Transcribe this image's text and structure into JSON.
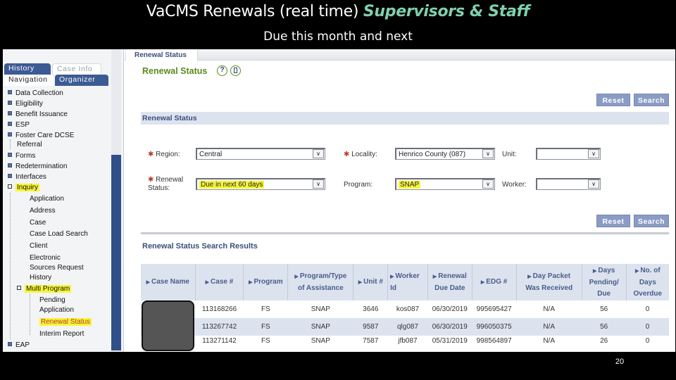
{
  "slide": {
    "title_main": "VaCMS Renewals (real time) ",
    "title_accent": "Supervisors & Staff",
    "subtitle": "Due this month and next",
    "page_number": "20",
    "accent_color": "#7fd1b0"
  },
  "sidebar": {
    "tabs": {
      "history": "History",
      "case_info": "Case Info",
      "navigation": "Navigation",
      "organizer": "Organizer"
    },
    "items": [
      {
        "label": "Data Collection"
      },
      {
        "label": "Eligibility"
      },
      {
        "label": "Benefit Issuance"
      },
      {
        "label": "ESP"
      },
      {
        "label": "Foster Care DCSE",
        "label2": "Referral"
      },
      {
        "label": "Forms"
      },
      {
        "label": "Redetermination"
      },
      {
        "label": "Interfaces"
      },
      {
        "label": "Inquiry"
      },
      {
        "label": "EAP"
      }
    ],
    "inquiry_children": [
      "Application",
      "Address",
      "Case",
      "Case Load Search",
      "Client",
      "Electronic",
      "Sources Request",
      "History"
    ],
    "multi_program": "Multi Program",
    "multi_program_children": {
      "pending_1": "Pending",
      "pending_2": "Application",
      "renewal_status": "Renewal Status",
      "interim_report": "Interim Report"
    }
  },
  "main": {
    "tab_label": "Renewal Status",
    "page_heading": "Renewal Status",
    "help_icon": "?",
    "buttons": {
      "reset": "Reset",
      "search": "Search"
    },
    "filter_section_title": "Renewal Status",
    "filters": {
      "region": {
        "label": "Region:",
        "value": "Central",
        "required": true
      },
      "locality": {
        "label": "Locality:",
        "value": "Henrico County (087)",
        "required": true
      },
      "unit": {
        "label": "Unit:",
        "value": ""
      },
      "renewal_status": {
        "label1": "Renewal",
        "label2": "Status:",
        "value": "Due in next 60 days",
        "required": true
      },
      "program": {
        "label": "Program:",
        "value": "SNAP"
      },
      "worker": {
        "label": "Worker:",
        "value": ""
      }
    },
    "required_marker": "✱",
    "dropdown_arrow": "∨",
    "results_title": "Renewal Status Search Results",
    "results": {
      "columns": [
        {
          "l1": "Case Name",
          "l2": ""
        },
        {
          "l1": "Case #",
          "l2": ""
        },
        {
          "l1": "Program",
          "l2": ""
        },
        {
          "l1": "Program/Type",
          "l2": "of Assistance"
        },
        {
          "l1": "Unit #",
          "l2": ""
        },
        {
          "l1": "Worker",
          "l2": "Id"
        },
        {
          "l1": "Renewal",
          "l2": "Due Date"
        },
        {
          "l1": "EDG #",
          "l2": ""
        },
        {
          "l1": "Day Packet",
          "l2": "Was Received"
        },
        {
          "l1": "Days",
          "l2": "Pending/",
          "l3": "Due"
        },
        {
          "l1": "No. of",
          "l2": "Days",
          "l3": "Overdue"
        }
      ],
      "rows": [
        {
          "case_name": "",
          "case_no": "113168266",
          "program": "FS",
          "type": "SNAP",
          "unit": "3646",
          "worker": "kos087",
          "due_date": "06/30/2019",
          "edg": "995695427",
          "packet": "N/A",
          "days_pending": "56",
          "overdue": "0"
        },
        {
          "case_name": "",
          "case_no": "113267742",
          "program": "FS",
          "type": "SNAP",
          "unit": "9587",
          "worker": "qlg087",
          "due_date": "06/30/2019",
          "edg": "996050375",
          "packet": "N/A",
          "days_pending": "56",
          "overdue": "0"
        },
        {
          "case_name": "",
          "case_no": "113271142",
          "program": "FS",
          "type": "SNAP",
          "unit": "7587",
          "worker": "jfb087",
          "due_date": "05/31/2019",
          "edg": "998564897",
          "packet": "N/A",
          "days_pending": "26",
          "overdue": "0"
        }
      ]
    }
  }
}
